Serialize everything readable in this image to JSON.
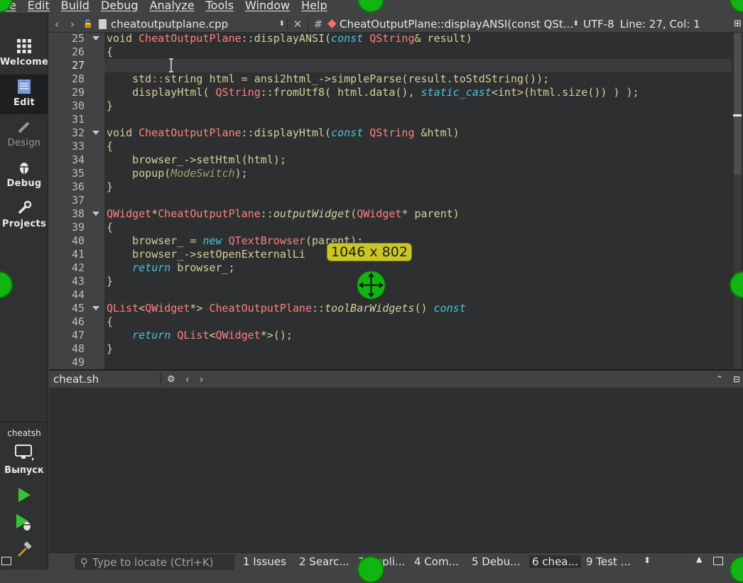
{
  "menu": [
    "File",
    "Edit",
    "Build",
    "Debug",
    "Analyze",
    "Tools",
    "Window",
    "Help"
  ],
  "modes": [
    {
      "label": "Welcome",
      "icon": "grid-icon",
      "state": "normal"
    },
    {
      "label": "Edit",
      "icon": "document-icon",
      "state": "active"
    },
    {
      "label": "Design",
      "icon": "pencil-icon",
      "state": "disabled"
    },
    {
      "label": "Debug",
      "icon": "bug-icon",
      "state": "normal"
    },
    {
      "label": "Projects",
      "icon": "wrench-icon",
      "state": "normal"
    }
  ],
  "kit": {
    "project": "cheatsh",
    "build": "Выпуск"
  },
  "toolbar": {
    "file_name": "cheatoutputplane.cpp",
    "hash": "#",
    "symbol": "CheatOutputPlane::displayANSI(const QSt...",
    "encoding": "UTF-8",
    "position": "Line: 27, Col: 1"
  },
  "editor": {
    "current_line": 27,
    "lines": [
      {
        "n": "25",
        "fold": true,
        "tokens": [
          [
            "t-plain",
            "void "
          ],
          [
            "t-type",
            "CheatOutputPlane"
          ],
          [
            "t-plain",
            "::displayANSI("
          ],
          [
            "t-kw",
            "const"
          ],
          [
            "t-plain",
            " "
          ],
          [
            "t-type",
            "QString"
          ],
          [
            "t-plain",
            "& result)"
          ]
        ]
      },
      {
        "n": "26",
        "fold": false,
        "tokens": [
          [
            "t-plain",
            "{"
          ]
        ]
      },
      {
        "n": "27",
        "fold": false,
        "tokens": [
          [
            "t-plain",
            ""
          ]
        ]
      },
      {
        "n": "28",
        "fold": false,
        "tokens": [
          [
            "t-plain",
            "    std"
          ],
          [
            "t-type",
            "::"
          ],
          [
            "t-plain",
            "string html = ansi2html_->simpleParse(result.toStdString());"
          ]
        ]
      },
      {
        "n": "29",
        "fold": false,
        "tokens": [
          [
            "t-plain",
            "    displayHtml( "
          ],
          [
            "t-type",
            "QString"
          ],
          [
            "t-plain",
            "::fromUtf8( html.data(), "
          ],
          [
            "t-kw",
            "static_cast"
          ],
          [
            "t-plain",
            "<int>(html.size()) ) );"
          ]
        ]
      },
      {
        "n": "30",
        "fold": false,
        "tokens": [
          [
            "t-plain",
            "}"
          ]
        ]
      },
      {
        "n": "31",
        "fold": false,
        "tokens": [
          [
            "t-plain",
            ""
          ]
        ]
      },
      {
        "n": "32",
        "fold": true,
        "tokens": [
          [
            "t-plain",
            "void "
          ],
          [
            "t-type",
            "CheatOutputPlane"
          ],
          [
            "t-plain",
            "::displayHtml("
          ],
          [
            "t-kw",
            "const"
          ],
          [
            "t-plain",
            " "
          ],
          [
            "t-type",
            "QString"
          ],
          [
            "t-plain",
            " &html)"
          ]
        ]
      },
      {
        "n": "33",
        "fold": false,
        "tokens": [
          [
            "t-plain",
            "{"
          ]
        ]
      },
      {
        "n": "34",
        "fold": false,
        "tokens": [
          [
            "t-plain",
            "    browser_->setHtml(html);"
          ]
        ]
      },
      {
        "n": "35",
        "fold": false,
        "tokens": [
          [
            "t-plain",
            "    popup("
          ],
          [
            "t-enum",
            "ModeSwitch"
          ],
          [
            "t-plain",
            ");"
          ]
        ]
      },
      {
        "n": "36",
        "fold": false,
        "tokens": [
          [
            "t-plain",
            "}"
          ]
        ]
      },
      {
        "n": "37",
        "fold": false,
        "tokens": [
          [
            "t-plain",
            ""
          ]
        ]
      },
      {
        "n": "38",
        "fold": true,
        "tokens": [
          [
            "t-type",
            "QWidget"
          ],
          [
            "t-plain",
            "*"
          ],
          [
            "t-type",
            "CheatOutputPlane"
          ],
          [
            "t-plain",
            "::"
          ],
          [
            "t-fnit",
            "outputWidget"
          ],
          [
            "t-plain",
            "("
          ],
          [
            "t-type",
            "QWidget"
          ],
          [
            "t-plain",
            "* parent)"
          ]
        ]
      },
      {
        "n": "39",
        "fold": false,
        "tokens": [
          [
            "t-plain",
            "{"
          ]
        ]
      },
      {
        "n": "40",
        "fold": false,
        "tokens": [
          [
            "t-plain",
            "    browser_ = "
          ],
          [
            "t-kw",
            "new"
          ],
          [
            "t-plain",
            " "
          ],
          [
            "t-type",
            "QTextBrowser"
          ],
          [
            "t-plain",
            "(parent);"
          ]
        ]
      },
      {
        "n": "41",
        "fold": false,
        "tokens": [
          [
            "t-plain",
            "    browser_->setOpenExternalLi"
          ]
        ]
      },
      {
        "n": "42",
        "fold": false,
        "tokens": [
          [
            "t-plain",
            "    "
          ],
          [
            "t-kw",
            "return"
          ],
          [
            "t-plain",
            " browser_;"
          ]
        ]
      },
      {
        "n": "43",
        "fold": false,
        "tokens": [
          [
            "t-plain",
            "}"
          ]
        ]
      },
      {
        "n": "44",
        "fold": false,
        "tokens": [
          [
            "t-plain",
            ""
          ]
        ]
      },
      {
        "n": "45",
        "fold": true,
        "tokens": [
          [
            "t-type",
            "QList"
          ],
          [
            "t-plain",
            "<"
          ],
          [
            "t-type",
            "QWidget"
          ],
          [
            "t-plain",
            "*> "
          ],
          [
            "t-type",
            "CheatOutputPlane"
          ],
          [
            "t-plain",
            "::"
          ],
          [
            "t-fnit",
            "toolBarWidgets"
          ],
          [
            "t-plain",
            "() "
          ],
          [
            "t-kw",
            "const"
          ]
        ]
      },
      {
        "n": "46",
        "fold": false,
        "tokens": [
          [
            "t-plain",
            "{"
          ]
        ]
      },
      {
        "n": "47",
        "fold": false,
        "tokens": [
          [
            "t-plain",
            "    "
          ],
          [
            "t-kw",
            "return"
          ],
          [
            "t-plain",
            " "
          ],
          [
            "t-type",
            "QList"
          ],
          [
            "t-plain",
            "<"
          ],
          [
            "t-type",
            "QWidget"
          ],
          [
            "t-plain",
            "*>();"
          ]
        ]
      },
      {
        "n": "48",
        "fold": false,
        "tokens": [
          [
            "t-plain",
            "}"
          ]
        ]
      },
      {
        "n": "49",
        "fold": false,
        "tokens": [
          [
            "t-plain",
            ""
          ]
        ]
      }
    ]
  },
  "output": {
    "title": "cheat.sh"
  },
  "statusbar": {
    "locator_placeholder": "Type to locate (Ctrl+K)",
    "panes": [
      "1 Issues",
      "2 Searc...",
      "3 Appli...",
      "4 Com...",
      "5 Debu...",
      "6 chea...",
      "9 Test ..."
    ],
    "active_pane": 5
  },
  "overlay": {
    "size_label": "1046 x 802"
  }
}
